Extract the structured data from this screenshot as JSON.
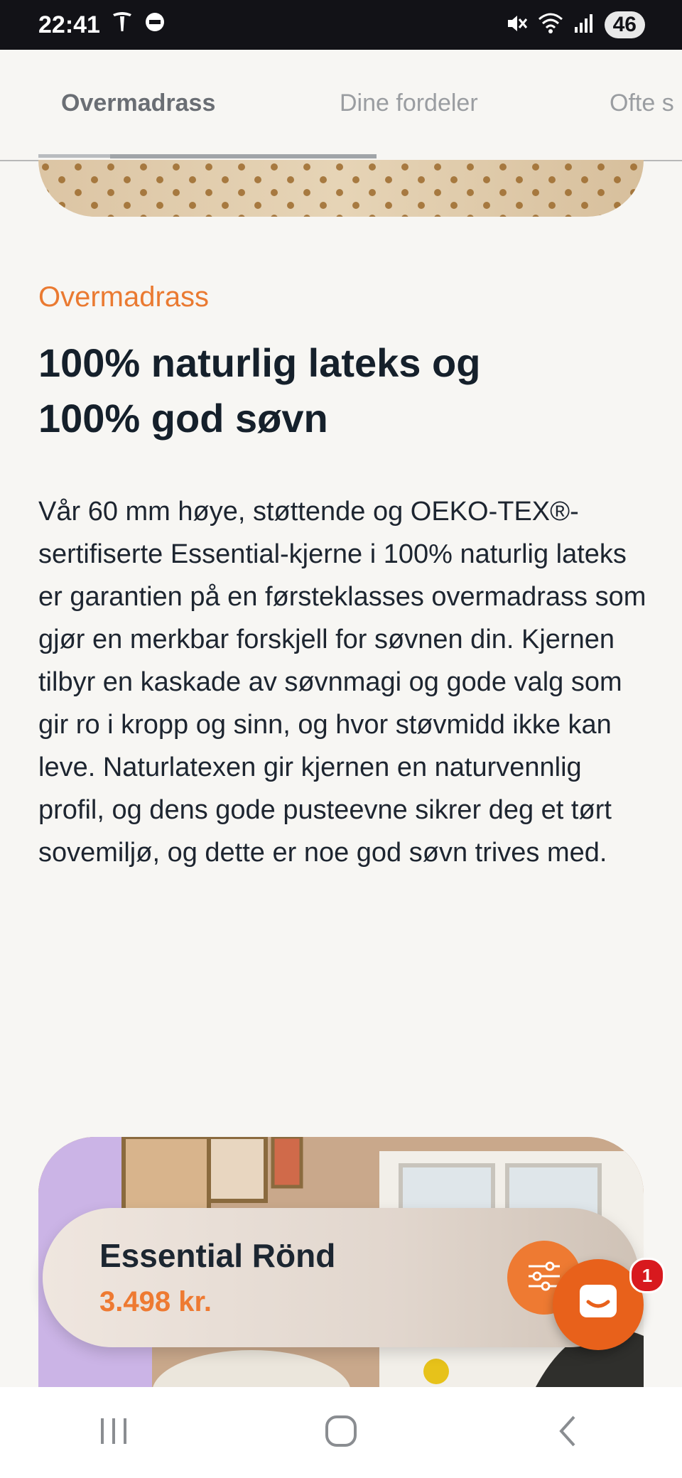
{
  "status_bar": {
    "time": "22:41",
    "battery": "46",
    "icons": [
      "tesla-icon",
      "circle-half-icon",
      "mute-icon",
      "wifi-icon",
      "signal-icon"
    ]
  },
  "tabs": [
    {
      "label": "Overmadrass",
      "active": true
    },
    {
      "label": "Dine fordeler",
      "active": false
    },
    {
      "label": "Ofte s",
      "active": false
    }
  ],
  "section": {
    "eyebrow": "Overmadrass",
    "headline_line1": "100% naturlig lateks og",
    "headline_line2": "100% god søvn",
    "body": "Vår 60 mm høye, støttende og OEKO-TEX®-sertifiserte Essential-kjerne i 100% naturlig lateks er garantien på en førsteklasses overmadrass som gjør en merkbar forskjell for søvnen din. Kjernen tilbyr en kaskade av søvnmagi og gode valg som gir ro i kropp og sinn, og hvor støvmidd ikke kan leve. Naturlatexen gir kjernen en naturvennlig profil, og dens gode pusteevne sikrer deg et tørt sovemiljø, og dette er noe god søvn trives med."
  },
  "product": {
    "name": "Essential Rönd",
    "price": "3.498 kr."
  },
  "chat": {
    "badge_count": "1"
  },
  "colors": {
    "accent": "#ee7a32",
    "text_dark": "#15202b",
    "background": "#f7f6f3",
    "badge": "#d8191e"
  }
}
